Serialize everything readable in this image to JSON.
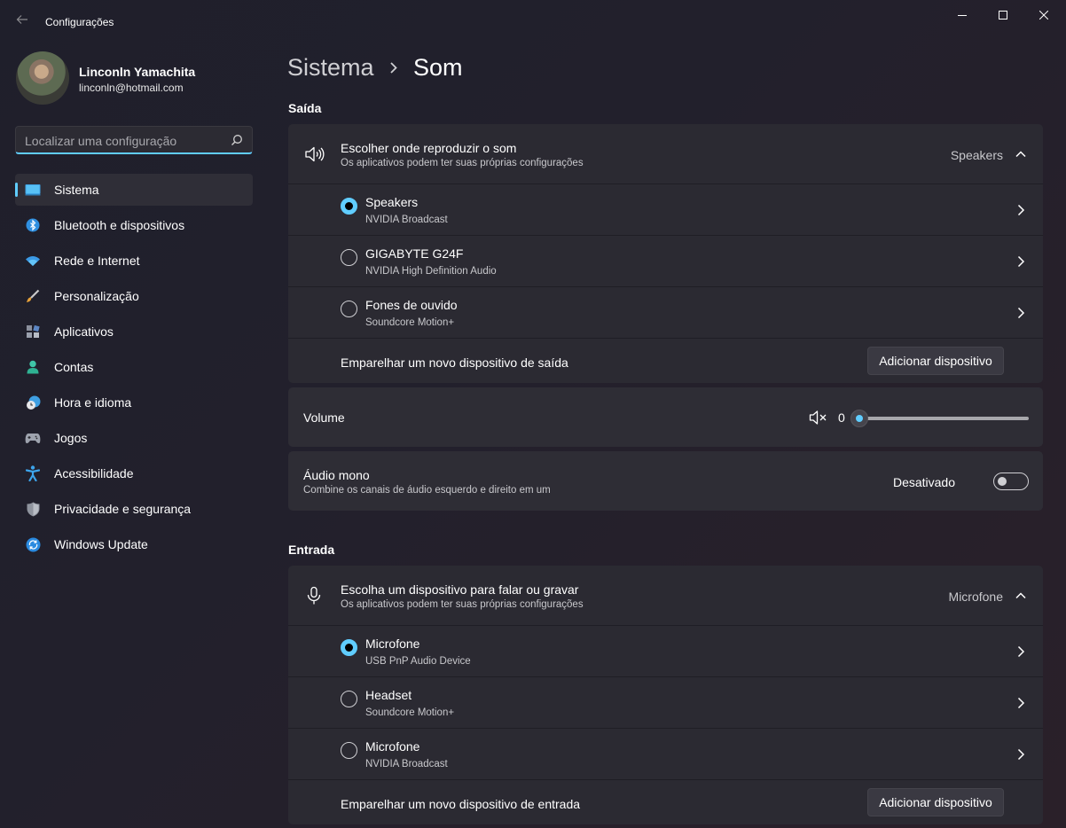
{
  "window": {
    "title": "Configurações"
  },
  "user": {
    "name": "Linconln Yamachita",
    "email": "linconln@hotmail.com"
  },
  "search": {
    "placeholder": "Localizar uma configuração"
  },
  "sidebar": {
    "items": [
      {
        "label": "Sistema",
        "icon": "monitor-icon",
        "active": true
      },
      {
        "label": "Bluetooth e dispositivos",
        "icon": "bluetooth-icon"
      },
      {
        "label": "Rede e Internet",
        "icon": "wifi-icon"
      },
      {
        "label": "Personalização",
        "icon": "brush-icon"
      },
      {
        "label": "Aplicativos",
        "icon": "apps-icon"
      },
      {
        "label": "Contas",
        "icon": "person-icon"
      },
      {
        "label": "Hora e idioma",
        "icon": "clock-globe-icon"
      },
      {
        "label": "Jogos",
        "icon": "gamepad-icon"
      },
      {
        "label": "Acessibilidade",
        "icon": "accessibility-icon"
      },
      {
        "label": "Privacidade e segurança",
        "icon": "shield-icon"
      },
      {
        "label": "Windows Update",
        "icon": "update-icon"
      }
    ]
  },
  "breadcrumb": {
    "parent": "Sistema",
    "current": "Som"
  },
  "output": {
    "section_title": "Saída",
    "header": {
      "title": "Escolher onde reproduzir o som",
      "subtitle": "Os aplicativos podem ter suas próprias configurações",
      "value": "Speakers"
    },
    "devices": [
      {
        "name": "Speakers",
        "detail": "NVIDIA Broadcast",
        "selected": true
      },
      {
        "name": "GIGABYTE G24F",
        "detail": "NVIDIA High Definition Audio",
        "selected": false
      },
      {
        "name": "Fones de ouvido",
        "detail": "Soundcore Motion+",
        "selected": false
      }
    ],
    "pair": {
      "label": "Emparelhar um novo dispositivo de saída",
      "button": "Adicionar dispositivo"
    },
    "volume": {
      "label": "Volume",
      "value": "0",
      "level": 0
    },
    "mono": {
      "title": "Áudio mono",
      "subtitle": "Combine os canais de áudio esquerdo e direito em um",
      "state": "Desativado",
      "on": false
    }
  },
  "input": {
    "section_title": "Entrada",
    "header": {
      "title": "Escolha um dispositivo para falar ou gravar",
      "subtitle": "Os aplicativos podem ter suas próprias configurações",
      "value": "Microfone"
    },
    "devices": [
      {
        "name": "Microfone",
        "detail": "USB PnP Audio Device",
        "selected": true
      },
      {
        "name": "Headset",
        "detail": "Soundcore Motion+",
        "selected": false
      },
      {
        "name": "Microfone",
        "detail": "NVIDIA Broadcast",
        "selected": false
      }
    ],
    "pair": {
      "label": "Emparelhar um novo dispositivo de entrada",
      "button": "Adicionar dispositivo"
    }
  },
  "colors": {
    "accent": "#60cdff",
    "card": "#2b2a32"
  }
}
